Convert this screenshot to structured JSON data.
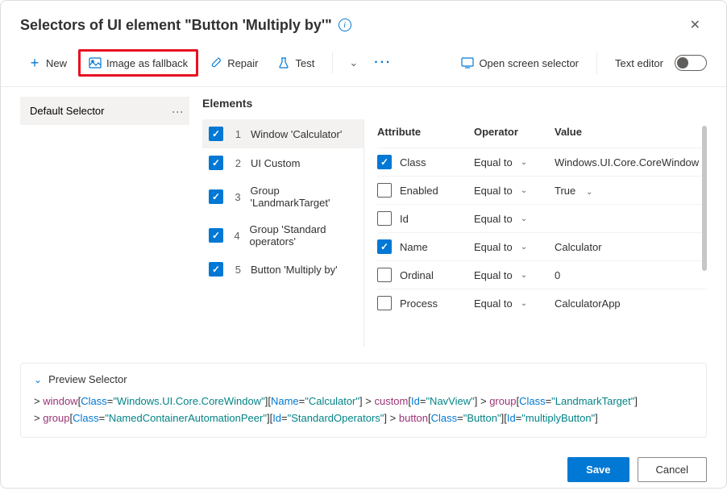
{
  "header": {
    "title": "Selectors of UI element \"Button 'Multiply by'\""
  },
  "toolbar": {
    "new": "New",
    "image_fallback": "Image as fallback",
    "repair": "Repair",
    "test": "Test",
    "open_screen_selector": "Open screen selector",
    "text_editor": "Text editor"
  },
  "selectors": {
    "default": "Default Selector"
  },
  "elements": {
    "heading": "Elements",
    "items": [
      {
        "num": "1",
        "label": "Window 'Calculator'"
      },
      {
        "num": "2",
        "label": "UI Custom"
      },
      {
        "num": "3",
        "label": "Group 'LandmarkTarget'"
      },
      {
        "num": "4",
        "label": "Group 'Standard operators'"
      },
      {
        "num": "5",
        "label": "Button 'Multiply by'"
      }
    ]
  },
  "attributes": {
    "headers": {
      "attribute": "Attribute",
      "operator": "Operator",
      "value": "Value"
    },
    "rows": [
      {
        "checked": true,
        "name": "Class",
        "operator": "Equal to",
        "has_value_chevron": false,
        "value": "Windows.UI.Core.CoreWindow"
      },
      {
        "checked": false,
        "name": "Enabled",
        "operator": "Equal to",
        "has_value_chevron": true,
        "value": "True"
      },
      {
        "checked": false,
        "name": "Id",
        "operator": "Equal to",
        "has_value_chevron": false,
        "value": ""
      },
      {
        "checked": true,
        "name": "Name",
        "operator": "Equal to",
        "has_value_chevron": false,
        "value": "Calculator"
      },
      {
        "checked": false,
        "name": "Ordinal",
        "operator": "Equal to",
        "has_value_chevron": false,
        "value": "0"
      },
      {
        "checked": false,
        "name": "Process",
        "operator": "Equal to",
        "has_value_chevron": false,
        "value": "CalculatorApp"
      }
    ]
  },
  "preview": {
    "title": "Preview Selector",
    "tokens": [
      {
        "t": "gt",
        "v": "> "
      },
      {
        "t": "tag",
        "v": "window"
      },
      {
        "t": "br",
        "v": "["
      },
      {
        "t": "attr",
        "v": "Class"
      },
      {
        "t": "eq",
        "v": "="
      },
      {
        "t": "val",
        "v": "\"Windows.UI.Core.CoreWindow\""
      },
      {
        "t": "br",
        "v": "]"
      },
      {
        "t": "br",
        "v": "["
      },
      {
        "t": "attr",
        "v": "Name"
      },
      {
        "t": "eq",
        "v": "="
      },
      {
        "t": "val",
        "v": "\"Calculator\""
      },
      {
        "t": "br",
        "v": "]"
      },
      {
        "t": "gt",
        "v": " > "
      },
      {
        "t": "tag",
        "v": "custom"
      },
      {
        "t": "br",
        "v": "["
      },
      {
        "t": "attr",
        "v": "Id"
      },
      {
        "t": "eq",
        "v": "="
      },
      {
        "t": "val",
        "v": "\"NavView\""
      },
      {
        "t": "br",
        "v": "]"
      },
      {
        "t": "gt",
        "v": " > "
      },
      {
        "t": "tag",
        "v": "group"
      },
      {
        "t": "br",
        "v": "["
      },
      {
        "t": "attr",
        "v": "Class"
      },
      {
        "t": "eq",
        "v": "="
      },
      {
        "t": "val",
        "v": "\"LandmarkTarget\""
      },
      {
        "t": "br",
        "v": "]"
      },
      {
        "t": "nl"
      },
      {
        "t": "gt",
        "v": "> "
      },
      {
        "t": "tag",
        "v": "group"
      },
      {
        "t": "br",
        "v": "["
      },
      {
        "t": "attr",
        "v": "Class"
      },
      {
        "t": "eq",
        "v": "="
      },
      {
        "t": "val",
        "v": "\"NamedContainerAutomationPeer\""
      },
      {
        "t": "br",
        "v": "]"
      },
      {
        "t": "br",
        "v": "["
      },
      {
        "t": "attr",
        "v": "Id"
      },
      {
        "t": "eq",
        "v": "="
      },
      {
        "t": "val",
        "v": "\"StandardOperators\""
      },
      {
        "t": "br",
        "v": "]"
      },
      {
        "t": "gt",
        "v": " > "
      },
      {
        "t": "tag",
        "v": "button"
      },
      {
        "t": "br",
        "v": "["
      },
      {
        "t": "attr",
        "v": "Class"
      },
      {
        "t": "eq",
        "v": "="
      },
      {
        "t": "val",
        "v": "\"Button\""
      },
      {
        "t": "br",
        "v": "]"
      },
      {
        "t": "br",
        "v": "["
      },
      {
        "t": "attr",
        "v": "Id"
      },
      {
        "t": "eq",
        "v": "="
      },
      {
        "t": "val",
        "v": "\"multiplyButton\""
      },
      {
        "t": "br",
        "v": "]"
      }
    ]
  },
  "footer": {
    "save": "Save",
    "cancel": "Cancel"
  }
}
